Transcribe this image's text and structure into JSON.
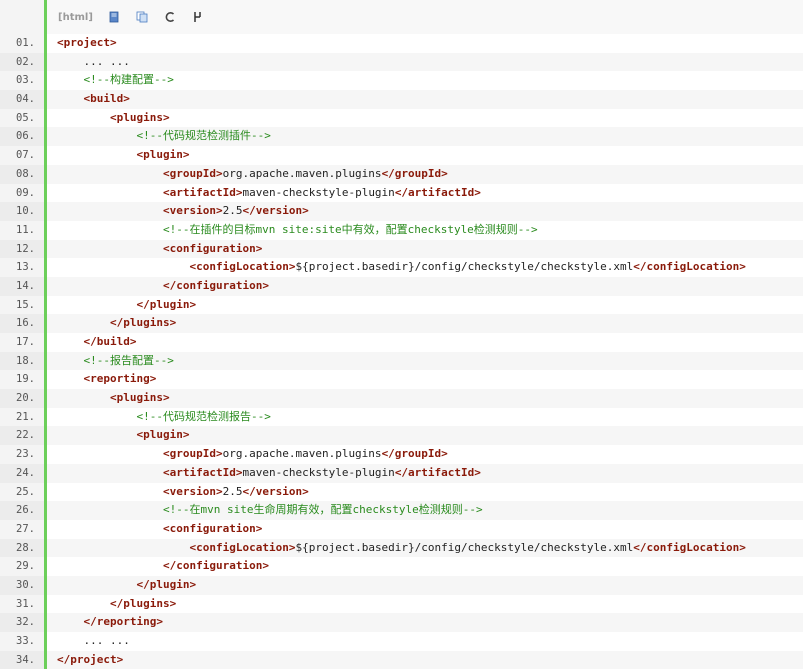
{
  "toolbar": {
    "lang_label": "[html]",
    "icons": [
      "view-source-icon",
      "copy-icon",
      "refresh-icon",
      "info-icon"
    ]
  },
  "colors": {
    "tag": "#8a1a0a",
    "comment": "#2a8b1e",
    "text": "#222222",
    "line_number": "#555555",
    "gutter_accent": "#6ccf5a"
  },
  "lines": [
    {
      "num": "01.",
      "indent": 0,
      "parts": [
        {
          "t": "tag",
          "v": "<project>"
        }
      ]
    },
    {
      "num": "02.",
      "indent": 1,
      "parts": [
        {
          "t": "txt",
          "v": "... ..."
        }
      ]
    },
    {
      "num": "03.",
      "indent": 1,
      "parts": [
        {
          "t": "cmt",
          "v": "<!--构建配置-->"
        }
      ]
    },
    {
      "num": "04.",
      "indent": 1,
      "parts": [
        {
          "t": "tag",
          "v": "<build>"
        }
      ]
    },
    {
      "num": "05.",
      "indent": 2,
      "parts": [
        {
          "t": "tag",
          "v": "<plugins>"
        }
      ]
    },
    {
      "num": "06.",
      "indent": 3,
      "parts": [
        {
          "t": "cmt",
          "v": "<!--代码规范检测插件-->"
        }
      ]
    },
    {
      "num": "07.",
      "indent": 3,
      "parts": [
        {
          "t": "tag",
          "v": "<plugin>"
        }
      ]
    },
    {
      "num": "08.",
      "indent": 4,
      "parts": [
        {
          "t": "tag",
          "v": "<groupId>"
        },
        {
          "t": "txt",
          "v": "org.apache.maven.plugins"
        },
        {
          "t": "tag",
          "v": "</groupId>"
        }
      ]
    },
    {
      "num": "09.",
      "indent": 4,
      "parts": [
        {
          "t": "tag",
          "v": "<artifactId>"
        },
        {
          "t": "txt",
          "v": "maven-checkstyle-plugin"
        },
        {
          "t": "tag",
          "v": "</artifactId>"
        }
      ]
    },
    {
      "num": "10.",
      "indent": 4,
      "parts": [
        {
          "t": "tag",
          "v": "<version>"
        },
        {
          "t": "txt",
          "v": "2.5"
        },
        {
          "t": "tag",
          "v": "</version>"
        }
      ]
    },
    {
      "num": "11.",
      "indent": 4,
      "parts": [
        {
          "t": "cmt",
          "v": "<!--在插件的目标mvn site:site中有效，配置checkstyle检测规则-->"
        }
      ]
    },
    {
      "num": "12.",
      "indent": 4,
      "parts": [
        {
          "t": "tag",
          "v": "<configuration>"
        }
      ]
    },
    {
      "num": "13.",
      "indent": 5,
      "parts": [
        {
          "t": "tag",
          "v": "<configLocation>"
        },
        {
          "t": "txt",
          "v": "${project.basedir}/config/checkstyle/checkstyle.xml"
        },
        {
          "t": "tag",
          "v": "</configLocation>"
        }
      ]
    },
    {
      "num": "14.",
      "indent": 4,
      "parts": [
        {
          "t": "tag",
          "v": "</configuration>"
        }
      ]
    },
    {
      "num": "15.",
      "indent": 3,
      "parts": [
        {
          "t": "tag",
          "v": "</plugin>"
        }
      ]
    },
    {
      "num": "16.",
      "indent": 2,
      "parts": [
        {
          "t": "tag",
          "v": "</plugins>"
        }
      ]
    },
    {
      "num": "17.",
      "indent": 1,
      "parts": [
        {
          "t": "tag",
          "v": "</build>"
        }
      ]
    },
    {
      "num": "18.",
      "indent": 1,
      "parts": [
        {
          "t": "cmt",
          "v": "<!--报告配置-->"
        }
      ]
    },
    {
      "num": "19.",
      "indent": 1,
      "parts": [
        {
          "t": "tag",
          "v": "<reporting>"
        }
      ]
    },
    {
      "num": "20.",
      "indent": 2,
      "parts": [
        {
          "t": "tag",
          "v": "<plugins>"
        }
      ]
    },
    {
      "num": "21.",
      "indent": 3,
      "parts": [
        {
          "t": "cmt",
          "v": "<!--代码规范检测报告-->"
        }
      ]
    },
    {
      "num": "22.",
      "indent": 3,
      "parts": [
        {
          "t": "tag",
          "v": "<plugin>"
        }
      ]
    },
    {
      "num": "23.",
      "indent": 4,
      "parts": [
        {
          "t": "tag",
          "v": "<groupId>"
        },
        {
          "t": "txt",
          "v": "org.apache.maven.plugins"
        },
        {
          "t": "tag",
          "v": "</groupId>"
        }
      ]
    },
    {
      "num": "24.",
      "indent": 4,
      "parts": [
        {
          "t": "tag",
          "v": "<artifactId>"
        },
        {
          "t": "txt",
          "v": "maven-checkstyle-plugin"
        },
        {
          "t": "tag",
          "v": "</artifactId>"
        }
      ]
    },
    {
      "num": "25.",
      "indent": 4,
      "parts": [
        {
          "t": "tag",
          "v": "<version>"
        },
        {
          "t": "txt",
          "v": "2.5"
        },
        {
          "t": "tag",
          "v": "</version>"
        }
      ]
    },
    {
      "num": "26.",
      "indent": 4,
      "parts": [
        {
          "t": "cmt",
          "v": "<!--在mvn site生命周期有效，配置checkstyle检测规则-->"
        }
      ]
    },
    {
      "num": "27.",
      "indent": 4,
      "parts": [
        {
          "t": "tag",
          "v": "<configuration>"
        }
      ]
    },
    {
      "num": "28.",
      "indent": 5,
      "parts": [
        {
          "t": "tag",
          "v": "<configLocation>"
        },
        {
          "t": "txt",
          "v": "${project.basedir}/config/checkstyle/checkstyle.xml"
        },
        {
          "t": "tag",
          "v": "</configLocation>"
        }
      ]
    },
    {
      "num": "29.",
      "indent": 4,
      "parts": [
        {
          "t": "tag",
          "v": "</configuration>"
        }
      ]
    },
    {
      "num": "30.",
      "indent": 3,
      "parts": [
        {
          "t": "tag",
          "v": "</plugin>"
        }
      ]
    },
    {
      "num": "31.",
      "indent": 2,
      "parts": [
        {
          "t": "tag",
          "v": "</plugins>"
        }
      ]
    },
    {
      "num": "32.",
      "indent": 1,
      "parts": [
        {
          "t": "tag",
          "v": "</reporting>"
        }
      ]
    },
    {
      "num": "33.",
      "indent": 1,
      "parts": [
        {
          "t": "txt",
          "v": "... ..."
        }
      ]
    },
    {
      "num": "34.",
      "indent": 0,
      "parts": [
        {
          "t": "tag",
          "v": "</project>"
        }
      ]
    }
  ]
}
